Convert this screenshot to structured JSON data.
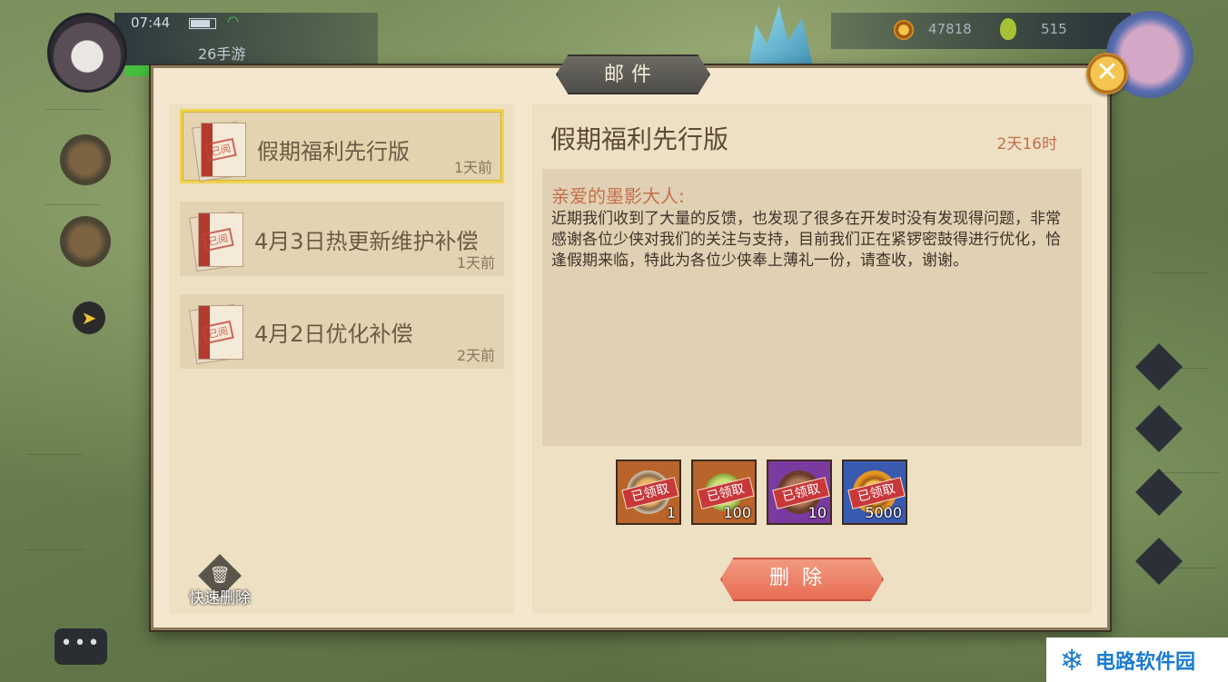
{
  "hud": {
    "time": "07:44",
    "player_name": "26手游",
    "coins": "47818",
    "jade": "515"
  },
  "dialog": {
    "title": "邮件",
    "close_label": "✕"
  },
  "mails": [
    {
      "subject": "假期福利先行版",
      "time": "1天前",
      "stamp": "已阅",
      "selected": true
    },
    {
      "subject": "4月3日热更新维护补偿",
      "time": "1天前",
      "stamp": "已阅",
      "selected": false
    },
    {
      "subject": "4月2日优化补偿",
      "time": "2天前",
      "stamp": "已阅",
      "selected": false
    }
  ],
  "quick_delete_label": "快速删除",
  "detail": {
    "title": "假期福利先行版",
    "expire": "2天16时",
    "greeting": "亲爱的墨影大人:",
    "body": "近期我们收到了大量的反馈，也发现了很多在开发时没有发现得问题，非常感谢各位少侠对我们的关注与支持，目前我们正在紧锣密鼓得进行优化，恰逢假期来临，特此为各位少侠奉上薄礼一份，请查收，谢谢。",
    "rewards": [
      {
        "claimed_label": "已领取",
        "quantity": "1",
        "frame_color": "#b8642a",
        "icon": "food-plate-icon"
      },
      {
        "claimed_label": "已领取",
        "quantity": "100",
        "frame_color": "#b8642a",
        "icon": "jade-icon"
      },
      {
        "claimed_label": "已领取",
        "quantity": "10",
        "frame_color": "#7a3aa0",
        "icon": "token-icon"
      },
      {
        "claimed_label": "已领取",
        "quantity": "5000",
        "frame_color": "#3a5ab0",
        "icon": "coin-icon"
      }
    ],
    "delete_label": "删除"
  },
  "watermark": "电路软件园"
}
